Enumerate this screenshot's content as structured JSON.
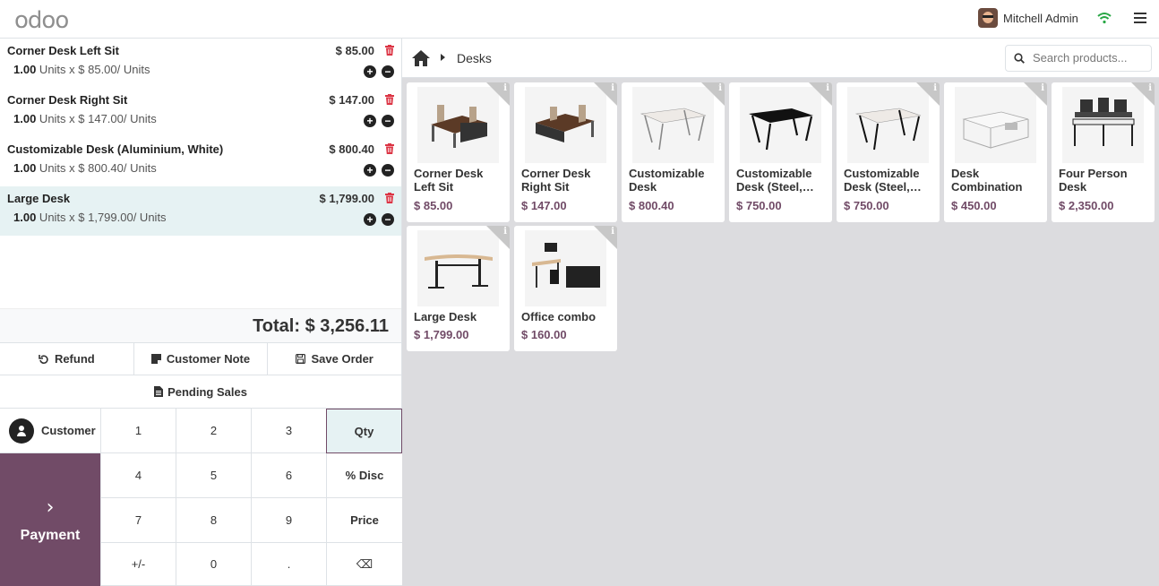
{
  "header": {
    "logo": "odoo",
    "user_name": "Mitchell Admin"
  },
  "order": {
    "lines": [
      {
        "name": "Corner Desk Left Sit",
        "price": "$ 85.00",
        "qty": "1.00",
        "detail": " Units x $ 85.00/ Units",
        "selected": false
      },
      {
        "name": "Corner Desk Right Sit",
        "price": "$ 147.00",
        "qty": "1.00",
        "detail": " Units x $ 147.00/ Units",
        "selected": false
      },
      {
        "name": "Customizable Desk (Aluminium, White)",
        "price": "$ 800.40",
        "qty": "1.00",
        "detail": " Units x $ 800.40/ Units",
        "selected": false
      },
      {
        "name": "Large Desk",
        "price": "$ 1,799.00",
        "qty": "1.00",
        "detail": " Units x $ 1,799.00/ Units",
        "selected": true
      }
    ],
    "total": "Total: $ 3,256.11"
  },
  "actions": {
    "refund": "Refund",
    "customer_note": "Customer Note",
    "save_order": "Save Order",
    "pending_sales": "Pending Sales"
  },
  "customer": {
    "label": "Customer"
  },
  "payment": {
    "label": "Payment"
  },
  "numpad": {
    "keys": [
      "1",
      "2",
      "3",
      "Qty",
      "4",
      "5",
      "6",
      "% Disc",
      "7",
      "8",
      "9",
      "Price",
      "+/-",
      "0",
      ".",
      "⌫"
    ],
    "active": "Qty"
  },
  "products_header": {
    "breadcrumb": "Desks",
    "search_placeholder": "Search products..."
  },
  "products": [
    {
      "name": "Corner Desk Left Sit",
      "price": "$ 85.00",
      "icon": "corner-desk-image"
    },
    {
      "name": "Corner Desk Right Sit",
      "price": "$ 147.00",
      "icon": "corner-desk-image"
    },
    {
      "name": "Customizable Desk (Aluminiu…",
      "price": "$ 800.40",
      "icon": "white-desk-image"
    },
    {
      "name": "Customizable Desk (Steel,…",
      "price": "$ 750.00",
      "icon": "black-desk-image"
    },
    {
      "name": "Customizable Desk (Steel,…",
      "price": "$ 750.00",
      "icon": "white-desk-image"
    },
    {
      "name": "Desk Combination",
      "price": "$ 450.00",
      "icon": "desk-combination-image"
    },
    {
      "name": "Four Person Desk",
      "price": "$ 2,350.00",
      "icon": "four-person-desk-image"
    },
    {
      "name": "Large Desk",
      "price": "$ 1,799.00",
      "icon": "large-desk-image"
    },
    {
      "name": "Office combo",
      "price": "$ 160.00",
      "icon": "office-combo-image"
    }
  ],
  "colors": {
    "brand": "#714b67",
    "selected_line": "#e6f2f3",
    "trash": "#dc3545",
    "wifi": "#28a745"
  }
}
